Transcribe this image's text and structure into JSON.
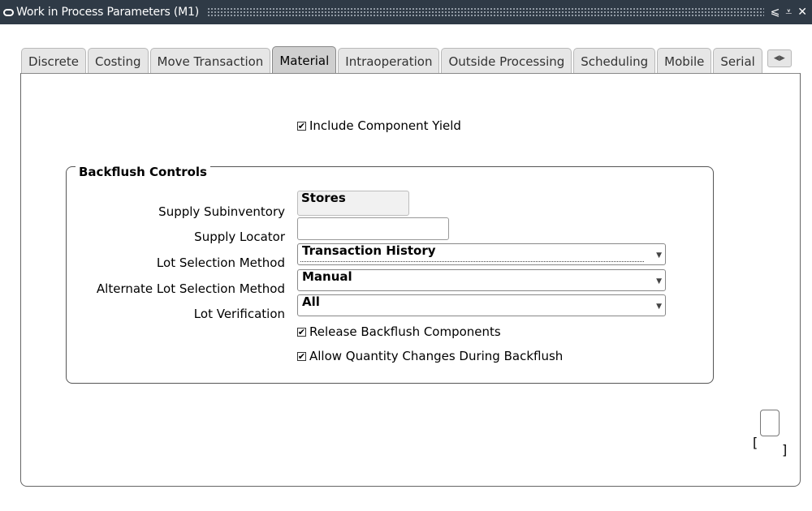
{
  "window": {
    "title": "Work in Process Parameters (M1)",
    "controls": [
      "⩽",
      "⩡",
      "✕"
    ]
  },
  "tabs": [
    {
      "label": "Discrete",
      "active": false
    },
    {
      "label": "Costing",
      "active": false
    },
    {
      "label": "Move Transaction",
      "active": false
    },
    {
      "label": "Material",
      "active": true
    },
    {
      "label": "Intraoperation",
      "active": false
    },
    {
      "label": "Outside Processing",
      "active": false
    },
    {
      "label": "Scheduling",
      "active": false
    },
    {
      "label": "Mobile",
      "active": false
    },
    {
      "label": "Serial",
      "active": false
    }
  ],
  "material": {
    "include_component_yield": {
      "label": "Include Component Yield",
      "checked": true
    },
    "backflush": {
      "title": "Backflush Controls",
      "supply_subinventory": {
        "label": "Supply Subinventory",
        "value": "Stores"
      },
      "supply_locator": {
        "label": "Supply Locator",
        "value": ""
      },
      "lot_selection_method": {
        "label": "Lot Selection Method",
        "value": "Transaction History"
      },
      "alternate_lot_selection_method": {
        "label": "Alternate Lot Selection Method",
        "value": "Manual"
      },
      "lot_verification": {
        "label": "Lot Verification",
        "value": "All"
      },
      "release_backflush_components": {
        "label": "Release Backflush Components",
        "checked": true
      },
      "allow_quantity_changes": {
        "label": "Allow Quantity Changes During Backflush",
        "checked": true
      }
    }
  },
  "descriptive_flexfield": {
    "left": "[",
    "right": "]"
  }
}
